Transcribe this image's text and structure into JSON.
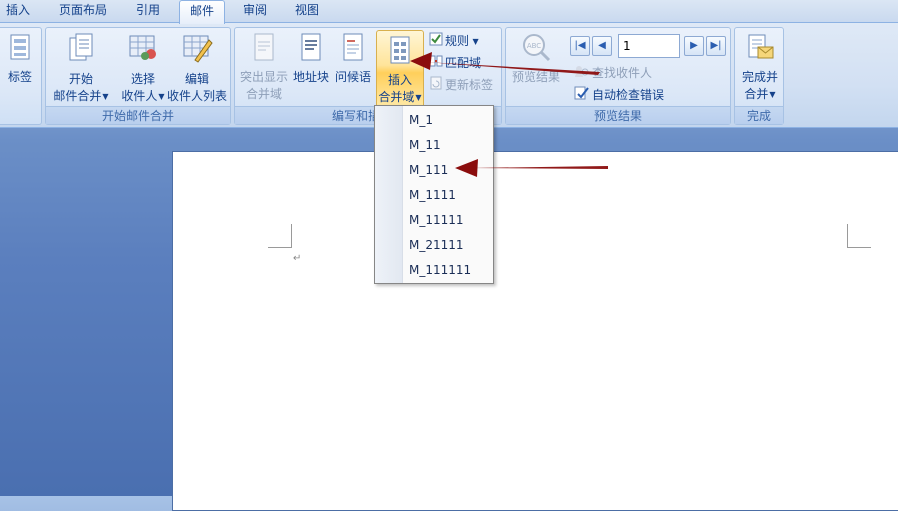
{
  "tabs": [
    {
      "label": "插入"
    },
    {
      "label": "页面布局"
    },
    {
      "label": "引用"
    },
    {
      "label": "邮件"
    },
    {
      "label": "审阅"
    },
    {
      "label": "视图"
    }
  ],
  "ribbon": {
    "group_create": {
      "labels_btn": "标签"
    },
    "group_start": {
      "label": "开始邮件合并",
      "start_btn": [
        "开始",
        "邮件合并"
      ],
      "select_btn": [
        "选择",
        "收件人"
      ],
      "edit_btn": [
        "编辑",
        "收件人列表"
      ]
    },
    "group_write": {
      "label": "编写和插入域",
      "highlight_btn": [
        "突出显示",
        "合并域"
      ],
      "address_btn": "地址块",
      "greeting_btn": "问候语",
      "insert_btn": [
        "插入",
        "合并域"
      ],
      "rules_btn": "规则",
      "match_btn": "匹配域",
      "update_btn": "更新标签"
    },
    "group_preview": {
      "label": "预览结果",
      "preview_btn": "预览结果",
      "record_value": "1",
      "find_btn": "查找收件人",
      "check_btn": "自动检查错误"
    },
    "group_finish": {
      "label": "完成",
      "finish_btn": [
        "完成并",
        "合并"
      ]
    }
  },
  "dropdown": {
    "items": [
      "M_1",
      "M_11",
      "M_111",
      "M_1111",
      "M_11111",
      "M_21111",
      "M_111111"
    ]
  },
  "document": {
    "para_mark": "↵"
  },
  "colors": {
    "annotation_arrow": "#8b0d0d",
    "active_tab_border": "#8db2e3"
  }
}
